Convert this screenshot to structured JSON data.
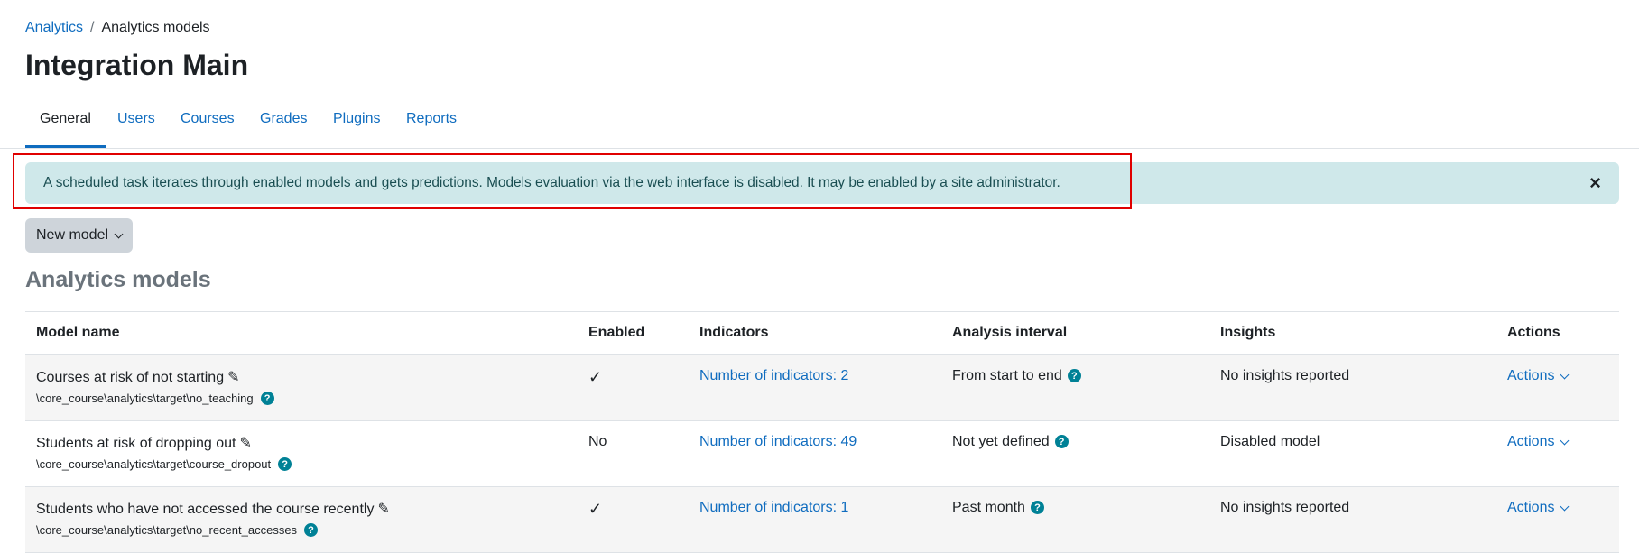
{
  "breadcrumb": {
    "root": "Analytics",
    "separator": "/",
    "current": "Analytics models"
  },
  "page_title": "Integration Main",
  "tabs": [
    {
      "label": "General",
      "active": true
    },
    {
      "label": "Users"
    },
    {
      "label": "Courses"
    },
    {
      "label": "Grades"
    },
    {
      "label": "Plugins"
    },
    {
      "label": "Reports"
    }
  ],
  "alert": {
    "message": "A scheduled task iterates through enabled models and gets predictions. Models evaluation via the web interface is disabled. It may be enabled by a site administrator.",
    "close_glyph": "×"
  },
  "new_model_button": "New model",
  "section_title": "Analytics models",
  "table": {
    "headers": [
      "Model name",
      "Enabled",
      "Indicators",
      "Analysis interval",
      "Insights",
      "Actions"
    ],
    "rows": [
      {
        "name": "Courses at risk of not starting",
        "target": "\\core_course\\analytics\\target\\no_teaching",
        "enabled": "✓",
        "indicators": "Number of indicators: 2",
        "interval": "From start to end",
        "insights": "No insights reported",
        "actions": "Actions"
      },
      {
        "name": "Students at risk of dropping out",
        "target": "\\core_course\\analytics\\target\\course_dropout",
        "enabled": "No",
        "indicators": "Number of indicators: 49",
        "interval": "Not yet defined",
        "insights": "Disabled model",
        "actions": "Actions"
      },
      {
        "name": "Students who have not accessed the course recently",
        "target": "\\core_course\\analytics\\target\\no_recent_accesses",
        "enabled": "✓",
        "indicators": "Number of indicators: 1",
        "interval": "Past month",
        "insights": "No insights reported",
        "actions": "Actions"
      }
    ]
  },
  "icons": {
    "edit": "pencil-icon",
    "help": "question-circle-icon",
    "dropdown": "chevron-down-icon",
    "close": "close-icon"
  },
  "colors": {
    "link": "#0f6cbf",
    "alert_bg": "#cfe8ea",
    "help_icon": "#008196",
    "highlight": "#e00000"
  }
}
